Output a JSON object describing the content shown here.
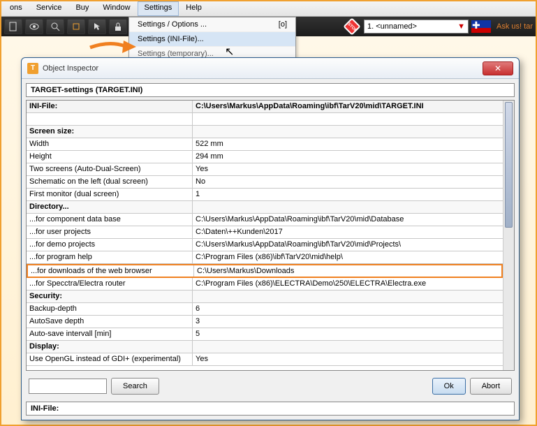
{
  "menubar": [
    "ons",
    "Service",
    "Buy",
    "Window",
    "Settings",
    "Help"
  ],
  "dropdown": {
    "items": [
      {
        "label": "Settings / Options ...",
        "shortcut": "[o]"
      },
      {
        "label": "Settings (INI-File)...",
        "shortcut": ""
      },
      {
        "label": "Settings (temporary)...",
        "shortcut": ""
      }
    ]
  },
  "toolbar": {
    "combo_value": "1. <unnamed>",
    "ask_text": "Ask us! tar"
  },
  "dialog": {
    "title": "Object Inspector",
    "title_field": "TARGET-settings (TARGET.INI)",
    "header": {
      "c1": "INI-File:",
      "c2": "C:\\Users\\Markus\\AppData\\Roaming\\ibf\\TarV20\\mid\\TARGET.INI"
    },
    "rows": [
      {
        "type": "spacer",
        "c1": "",
        "c2": ""
      },
      {
        "type": "section",
        "c1": "Screen size:",
        "c2": ""
      },
      {
        "type": "data",
        "c1": "Width",
        "c2": "522 mm"
      },
      {
        "type": "data",
        "c1": "Height",
        "c2": "294 mm"
      },
      {
        "type": "data",
        "c1": "Two screens (Auto-Dual-Screen)",
        "c2": "Yes"
      },
      {
        "type": "data",
        "c1": "Schematic on the left (dual screen)",
        "c2": "No"
      },
      {
        "type": "data",
        "c1": "First monitor (dual screen)",
        "c2": "1"
      },
      {
        "type": "section",
        "c1": "Directory...",
        "c2": ""
      },
      {
        "type": "data",
        "c1": "...for component data base",
        "c2": "C:\\Users\\Markus\\AppData\\Roaming\\ibf\\TarV20\\mid\\Database"
      },
      {
        "type": "data",
        "c1": "...for user projects",
        "c2": "C:\\Daten\\++Kunden\\2017"
      },
      {
        "type": "data",
        "c1": "...for demo projects",
        "c2": "C:\\Users\\Markus\\AppData\\Roaming\\ibf\\TarV20\\mid\\Projects\\"
      },
      {
        "type": "data",
        "c1": "...for program help",
        "c2": "C:\\Program Files (x86)\\ibf\\TarV20\\mid\\help\\"
      },
      {
        "type": "highlight",
        "c1": "...for downloads of the web browser",
        "c2": "C:\\Users\\Markus\\Downloads"
      },
      {
        "type": "data",
        "c1": "...for Specctra/Electra router",
        "c2": "C:\\Program Files (x86)\\ELECTRA\\Demo\\250\\ELECTRA\\Electra.exe"
      },
      {
        "type": "section",
        "c1": "Security:",
        "c2": ""
      },
      {
        "type": "data",
        "c1": "Backup-depth",
        "c2": "6"
      },
      {
        "type": "data",
        "c1": "AutoSave depth",
        "c2": "3"
      },
      {
        "type": "data",
        "c1": "Auto-save intervall [min]",
        "c2": "5"
      },
      {
        "type": "section",
        "c1": "Display:",
        "c2": ""
      },
      {
        "type": "data",
        "c1": "Use OpenGL instead of GDI+ (experimental)",
        "c2": "Yes"
      }
    ],
    "search_placeholder": "",
    "search_button": "Search",
    "ok_button": "Ok",
    "abort_button": "Abort",
    "status": "INI-File:"
  }
}
